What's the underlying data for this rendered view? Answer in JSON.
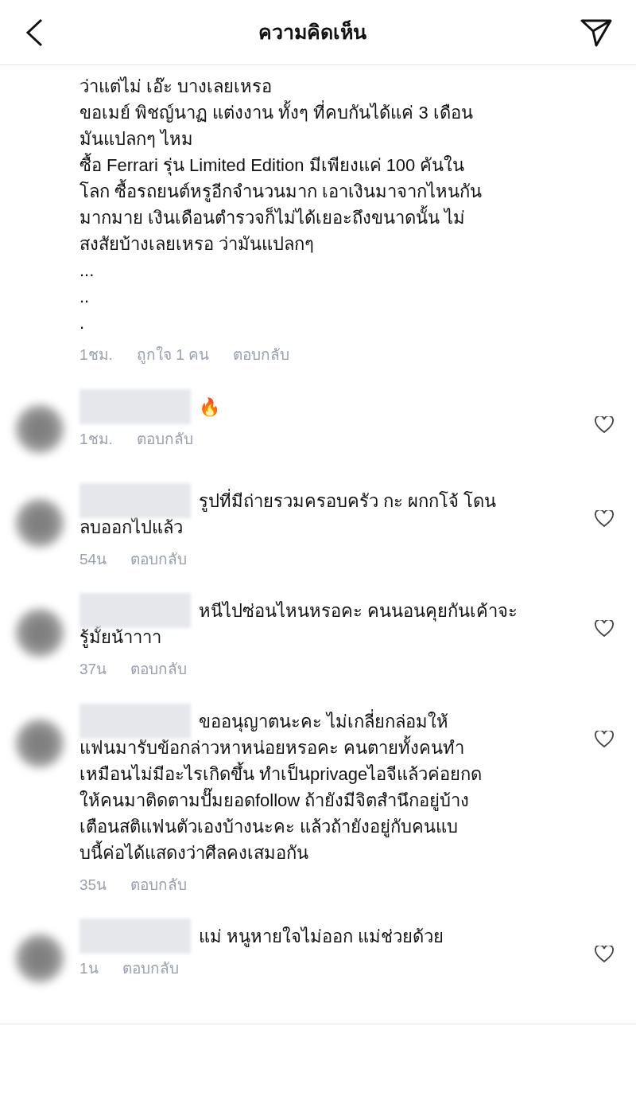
{
  "header": {
    "title": "ความคิดเห็น"
  },
  "comments": [
    {
      "has_user": false,
      "text": "ว่าแต่ไม่ เอ๊ะ บางเลยเหรอ\nขอเมย์ พิชญ์นาฏ แต่งงาน ทั้งๆ ที่คบกันได้แค่ 3 เดือน\nมันแปลกๆ ไหม\nซื้อ Ferrari รุ่น Limited Edition มีเพียงแค่ 100 คันใน\nโลก ซื้อรถยนต์หรูอีกจำนวนมาก เอาเงินมาจากไหนกัน\nมากมาย เงินเดือนตำรวจก็ไม่ได้เยอะถึงขนาดนั้น ไม่\nสงสัยบ้างเลยเหรอ ว่ามันแปลกๆ\n...\n..\n.",
      "time": "1ชม.",
      "likes": "ถูกใจ 1 คน",
      "reply": "ตอบกลับ"
    },
    {
      "has_user": true,
      "text": "🔥",
      "time": "1ชม.",
      "reply": "ตอบกลับ"
    },
    {
      "has_user": true,
      "text": "รูปที่มีถ่ายรวมครอบครัว กะ ผกกโจ้ โดน\nลบออกไปแล้ว",
      "time": "54น",
      "reply": "ตอบกลับ"
    },
    {
      "has_user": true,
      "text": "หนีไปซ่อนไหนหรอคะ คนนอนคุยกันเค้าจะ\nรู้มั้ยน้าาาา",
      "time": "37น",
      "reply": "ตอบกลับ"
    },
    {
      "has_user": true,
      "text": "ขออนุญาตนะคะ ไม่เกลี่ยกล่อมให้\nแฟนมารับข้อกล่าวหาหน่อยหรอคะ คนตายทั้งคนทำ\nเหมือนไม่มีอะไรเกิดขึ้น ทำเป็นprivageไอจีแล้วค่อยกด\nให้คนมาติดตามปั๊มยอดfollow ถ้ายังมีจิตสำนึกอยู่บ้าง\nเตือนสติแฟนตัวเองบ้างนะคะ แล้วถ้ายังอยู่กับคนแบ\nบนี้ค่อได้แสดงว่าศีลคงเสมอกัน",
      "time": "35น",
      "reply": "ตอบกลับ"
    },
    {
      "has_user": true,
      "text": "แม่ หนูหายใจไม่ออก แม่ช่วยด้วย",
      "time": "1น",
      "reply": "ตอบกลับ"
    }
  ]
}
